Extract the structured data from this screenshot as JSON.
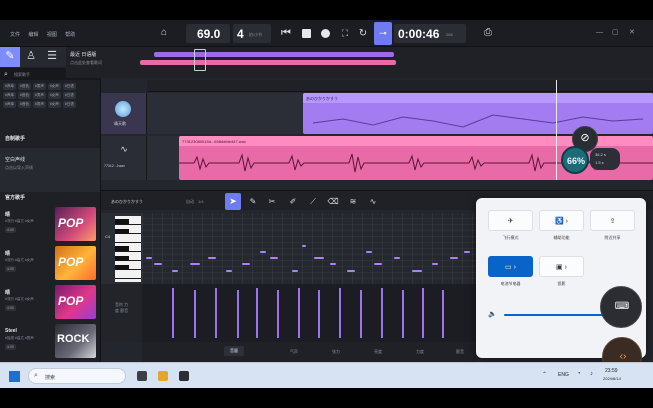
{
  "menu": [
    "文件",
    "编辑",
    "视图",
    "帮助"
  ],
  "transport": {
    "tempo": "69.0",
    "beats": "4",
    "beats_unit": "拍/小节",
    "time": "0:00:46",
    "time_sub": "266"
  },
  "project": {
    "title": "最近 日语版",
    "subtitle": "点击此处查看歌词"
  },
  "sidebar": {
    "search_placeholder": "搜索歌手",
    "tag_rows": [
      [
        "#声库",
        "#音色",
        "#男声",
        "#女声",
        "#日语"
      ],
      [
        "#声库",
        "#音色",
        "#男声",
        "#女声",
        "#日语"
      ],
      [
        "#声库",
        "#音色",
        "#男声",
        "#女声",
        "#日语"
      ]
    ],
    "custom_section": "自制歌手",
    "audio_track_title": "空白声线",
    "audio_track_sub": "点击以导入声线",
    "official_section": "官方歌手",
    "songs": [
      {
        "name": "晴",
        "meta": "#流行 #高亢 #女声",
        "tag": "4:00",
        "cover": "POP"
      },
      {
        "name": "晴",
        "meta": "#流行 #高亢 #女声",
        "tag": "4:00",
        "cover": "POP"
      },
      {
        "name": "晴",
        "meta": "#流行 #高亢 #女声",
        "tag": "4:00",
        "cover": "POP"
      },
      {
        "name": "Steel",
        "meta": "#摇滚 #高亢 #男声",
        "tag": "4:00",
        "cover": "ROCK"
      }
    ]
  },
  "tracks": {
    "vocal_track_name": "晴天歌",
    "audio_track_name": "77312...1wav",
    "vocal_clip_label": "あのひかりかすう",
    "audio_clip_label": "773123080019d...698ddfde447.wav"
  },
  "editor": {
    "clip_name": "あのひかりかすう",
    "key_label": "自动",
    "snap_label": "1/4",
    "octave_label": "C4",
    "param_hint": "音符 力度 颤音",
    "param_tabs": [
      "音量",
      "气声",
      "张力",
      "亮度",
      "力度",
      "颤音"
    ]
  },
  "overlay": {
    "zoom": "66%",
    "sub_stat_1": "36.2 s",
    "sub_stat_2": "1.5 s"
  },
  "quick_settings": {
    "tiles": [
      {
        "label": "飞行模式",
        "icon": "airplane-icon",
        "on": false
      },
      {
        "label": "辅助功能",
        "icon": "accessibility-icon",
        "on": false
      },
      {
        "label": "附近共享",
        "icon": "share-icon",
        "on": false
      },
      {
        "label": "电池节电器",
        "icon": "battery-saver-icon",
        "on": true
      },
      {
        "label": "投影",
        "icon": "cast-icon",
        "on": false
      }
    ],
    "volume_percent": 92
  },
  "taskbar": {
    "search_placeholder": "搜索",
    "lang": "ENG",
    "time": "23:59",
    "date": "2024/6/14"
  },
  "colors": {
    "accent_purple": "#a27cf0",
    "accent_pink": "#e86aa6",
    "accent_blue": "#0a63c9",
    "bg_dark": "#23262d"
  }
}
